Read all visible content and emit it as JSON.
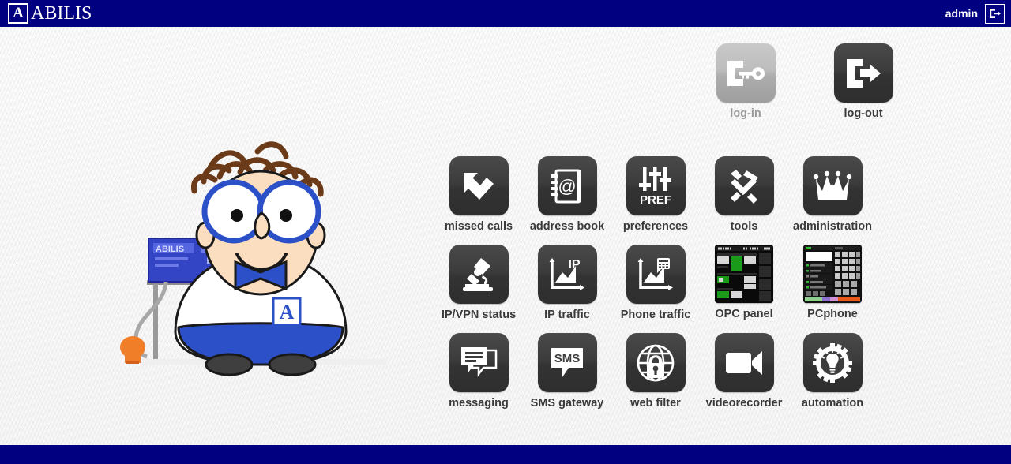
{
  "header": {
    "logo_mark": "A",
    "logo_text": "ABILIS",
    "user": "admin",
    "logout_icon": "logout-icon",
    "bg_color": "#000080"
  },
  "session_row": [
    {
      "id": "log-in",
      "label": "log-in",
      "icon": "login-key-icon",
      "enabled": false
    },
    {
      "id": "log-out",
      "label": "log-out",
      "icon": "logout-arrow-icon",
      "enabled": true
    }
  ],
  "main_grid": [
    {
      "id": "missed-calls",
      "label": "missed calls",
      "icon": "missed-call-arrow-icon"
    },
    {
      "id": "address-book",
      "label": "address book",
      "icon": "address-book-icon"
    },
    {
      "id": "preferences",
      "label": "preferences",
      "icon": "sliders-pref-icon",
      "badge": "PREF"
    },
    {
      "id": "tools",
      "label": "tools",
      "icon": "hammer-screwdriver-icon"
    },
    {
      "id": "administration",
      "label": "administration",
      "icon": "crown-icon"
    },
    {
      "id": "ip-vpn-status",
      "label": "IP/VPN status",
      "icon": "microscope-icon"
    },
    {
      "id": "ip-traffic",
      "label": "IP traffic",
      "icon": "graph-ip-icon",
      "badge": "IP"
    },
    {
      "id": "phone-traffic",
      "label": "Phone traffic",
      "icon": "graph-phone-icon"
    },
    {
      "id": "opc-panel",
      "label": "OPC panel",
      "icon": "opc-panel-thumbnail-icon"
    },
    {
      "id": "pcphone",
      "label": "PCphone",
      "icon": "pcphone-thumbnail-icon"
    },
    {
      "id": "messaging",
      "label": "messaging",
      "icon": "chat-bubbles-icon"
    },
    {
      "id": "sms-gateway",
      "label": "SMS gateway",
      "icon": "sms-bubble-icon",
      "badge": "SMS"
    },
    {
      "id": "web-filter",
      "label": "web filter",
      "icon": "globe-lock-icon"
    },
    {
      "id": "videorecorder",
      "label": "videorecorder",
      "icon": "video-camera-icon"
    },
    {
      "id": "automation",
      "label": "automation",
      "icon": "gear-bulb-icon"
    }
  ],
  "mascot": {
    "name": "abilis-mascot-illustration",
    "badge_letter": "A",
    "device_label": "ABILIS"
  },
  "footer": {
    "bg_color": "#000080"
  },
  "colors": {
    "brand_blue": "#000080",
    "icon_dark": "#383838",
    "icon_disabled": "#b4b4b4",
    "label_text": "#3a3a3a",
    "label_disabled": "#9a9a9a",
    "page_bg": "#fafafa"
  }
}
